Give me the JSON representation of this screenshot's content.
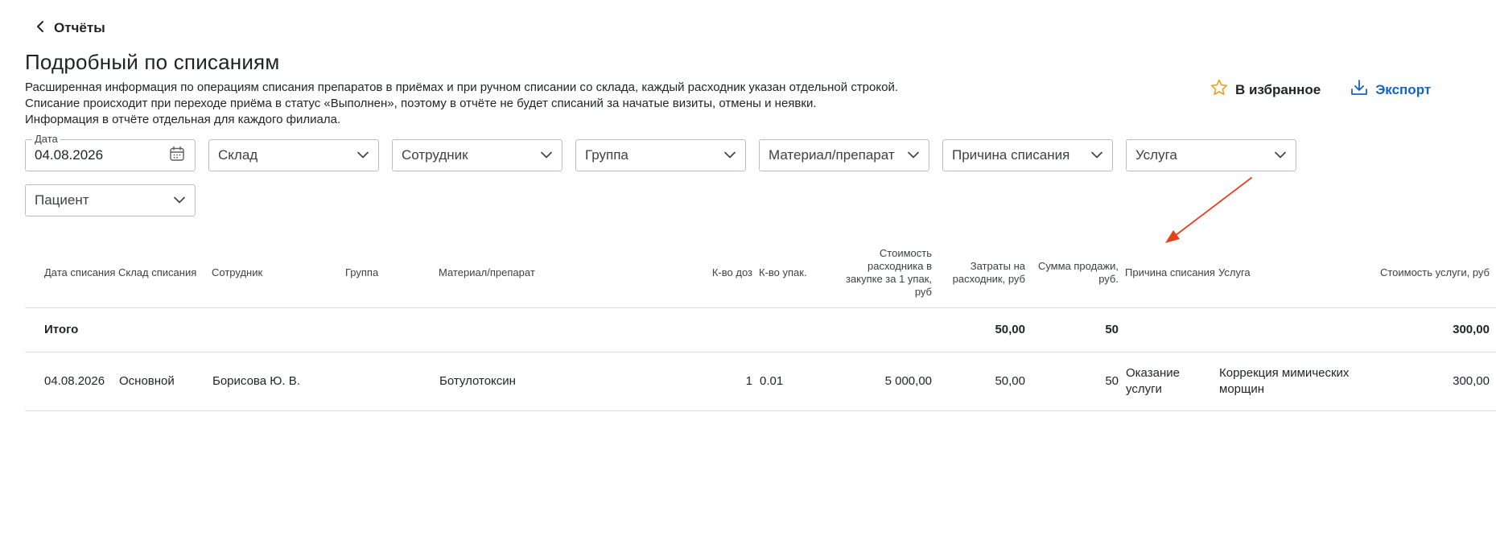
{
  "header": {
    "back_label": "Отчёты",
    "title": "Подробный по списаниям",
    "description": [
      "Расширенная информация по операциям списания препаратов в приёмах и при ручном списании со склада, каждый расходник указан отдельной строкой.",
      "Списание происходит при переходе приёма в статус «Выполнен», поэтому в отчёте не будет списаний за начатые визиты, отмены и неявки.",
      "Информация в отчёте отдельная для каждого филиала."
    ],
    "favorite_label": "В избранное",
    "export_label": "Экспорт"
  },
  "filters": {
    "date": {
      "legend": "Дата",
      "value": "04.08.2026"
    },
    "warehouse": "Склад",
    "employee": "Сотрудник",
    "group": "Группа",
    "material": "Материал/препарат",
    "reason": "Причина списания",
    "service": "Услуга",
    "patient": "Пациент"
  },
  "table": {
    "columns": [
      "Дата списания",
      "Склад списания",
      "Сотрудник",
      "Группа",
      "Материал/препарат",
      "К-во доз",
      "К-во упак.",
      "Стоимость расходника в закупке за 1 упак, руб",
      "Затраты на расходник, руб",
      "Сумма продажи, руб.",
      "Причина списания",
      "Услуга",
      "Стоимость услуги, руб"
    ],
    "total": {
      "label": "Итого",
      "costs": "50,00",
      "sales": "50",
      "service_cost": "300,00"
    },
    "rows": [
      {
        "date": "04.08.2026",
        "warehouse": "Основной",
        "employee": "Борисова Ю. В.",
        "group": "",
        "material": "Ботулотоксин",
        "doses": "1",
        "packs": "0.01",
        "unit_cost": "5 000,00",
        "costs": "50,00",
        "sales": "50",
        "reason": "Оказание услуги",
        "service": "Коррекция мимических морщин",
        "service_cost": "300,00"
      }
    ]
  },
  "colors": {
    "accent": "#1564c0",
    "star": "#f0a020",
    "annotation_arrow": "#e8401c",
    "border": "#b9bcc2"
  }
}
